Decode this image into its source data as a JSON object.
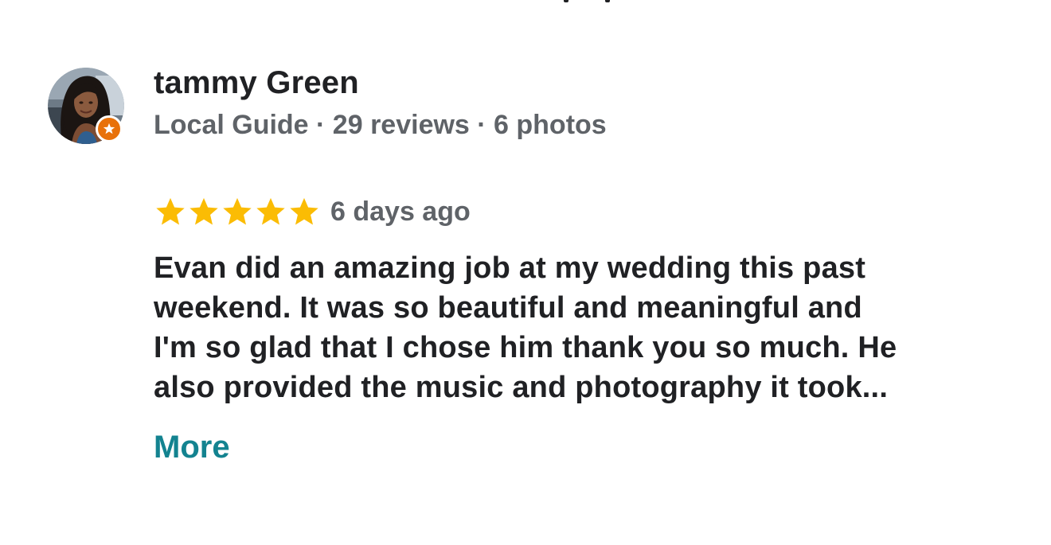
{
  "reviewer": {
    "name": "tammy Green",
    "meta": "Local Guide · 29 reviews · 6 photos",
    "badge_icon": "local-guide-star-icon",
    "avatar_icon": "profile-photo"
  },
  "review": {
    "rating": 5,
    "rating_max": 5,
    "date": "6 days ago",
    "text_lines": [
      "Evan did an amazing job at my wedding this past",
      "weekend. It was so beautiful and meaningful and",
      "I'm so glad that I chose him thank you so much. He",
      "also provided the music and photography it took..."
    ],
    "more_label": "More"
  },
  "colors": {
    "star": "#fbbc04",
    "badge": "#e8710a",
    "link": "#138390",
    "primary_text": "#202124",
    "secondary_text": "#5f6368"
  }
}
